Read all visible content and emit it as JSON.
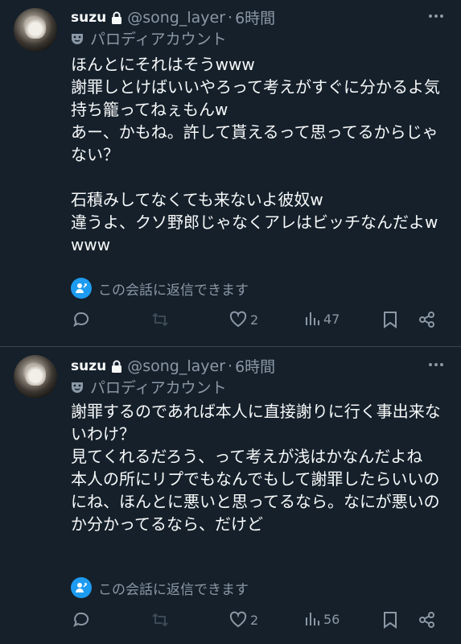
{
  "tweets": [
    {
      "display_name": "suzu",
      "handle": "@song_layer",
      "separator": "·",
      "time": "6時間",
      "parody_label": "パロディアカウント",
      "text": "ほんとにそれはそうwww\n謝罪しとけばいいやろって考えがすぐに分かるよ気持ち籠ってねぇもんw\nあー、かもね。許して貰えるって思ってるからじゃない？\n\n石積みしてなくても来ないよ彼奴w\n違うよ、クソ野郎じゃなくアレはビッチなんだよwwww",
      "reply_restriction": "この会話に返信できます",
      "likes": "2",
      "views": "47"
    },
    {
      "display_name": "suzu",
      "handle": "@song_layer",
      "separator": "·",
      "time": "6時間",
      "parody_label": "パロディアカウント",
      "text": "謝罪するのであれば本人に直接謝りに行く事出来ないわけ？\n見てくれるだろう、って考えが浅はかなんだよね\n本人の所にリプでもなんでもして謝罪したらいいのにね、ほんとに悪いと思ってるなら。なにが悪いのか分かってるなら、だけど",
      "reply_restriction": "この会話に返信できます",
      "likes": "2",
      "views": "56"
    }
  ],
  "colors": {
    "background": "#15202b",
    "text": "#f7f9f9",
    "muted": "#8b98a5",
    "accent": "#1d9bf0",
    "divider": "#38444d"
  },
  "icons": [
    "lock-icon",
    "more-icon",
    "parody-mask-icon",
    "reply-restriction-icon",
    "reply-icon",
    "retweet-icon",
    "like-icon",
    "views-icon",
    "bookmark-icon",
    "share-icon"
  ]
}
